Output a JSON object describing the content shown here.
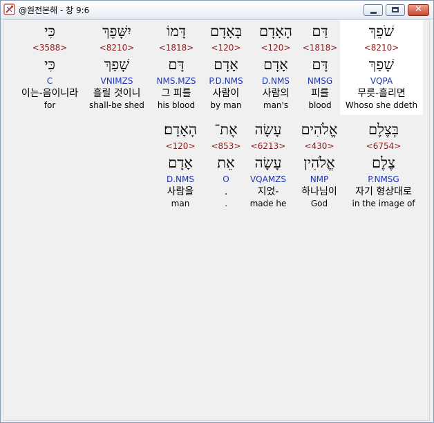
{
  "window": {
    "title": "@원전본해 - 창 9:6",
    "buttons": {
      "minimize": "minimize",
      "maximize": "maximize",
      "close": "✕"
    }
  },
  "words": [
    {
      "hebrew": "שֹׁפֵךְ",
      "strong": "<8210>",
      "lemma": "שָׁפַךְ",
      "morph": "VQPA",
      "korean": "무릇-흘리면",
      "english": "Whoso she ddeth",
      "highlighted": true
    },
    {
      "hebrew": "דַּם",
      "strong": "<1818>",
      "lemma": "דָּם",
      "morph": "NMSG",
      "korean": "피를",
      "english": "blood"
    },
    {
      "hebrew": "הָאָדָם",
      "strong": "<120>",
      "lemma": "אָדָם",
      "morph": "D.NMS",
      "korean": "사람의",
      "english": "man's"
    },
    {
      "hebrew": "בָּאָדָם",
      "strong": "<120>",
      "lemma": "אָדָם",
      "morph": "P.D.NMS",
      "korean": "사람이",
      "english": "by man"
    },
    {
      "hebrew": "דָּמוֹ",
      "strong": "<1818>",
      "lemma": "דָּם",
      "morph": "NMS.MZS",
      "korean": "그 피를",
      "english": "his blood"
    },
    {
      "hebrew": "יִשָּׁפֵךְ",
      "strong": "<8210>",
      "lemma": "שָׁפַךְ",
      "morph": "VNIMZS",
      "korean": "흘릴 것이니",
      "english": "shall-be shed"
    },
    {
      "hebrew": "כִּי",
      "strong": "<3588>",
      "lemma": "כִּי",
      "morph": "C",
      "korean": "이는-음이니라",
      "english": "for"
    },
    {
      "hebrew": "בְּצֶלֶם",
      "strong": "<6754>",
      "lemma": "צֶלֶם",
      "morph": "P.NMSG",
      "korean": "자기 형상대로",
      "english": "in the image of"
    },
    {
      "hebrew": "אֱלֹהִים",
      "strong": "<430>",
      "lemma": "אֱלֹהִין",
      "morph": "NMP",
      "korean": "하나님이",
      "english": "God"
    },
    {
      "hebrew": "עָשָׂה",
      "strong": "<6213>",
      "lemma": "עָשָׂה",
      "morph": "VQAMZS",
      "korean": "지었-",
      "english": "made he"
    },
    {
      "hebrew": "אֶת־",
      "strong": "<853>",
      "lemma": "אֵת",
      "morph": "O",
      "korean": ".",
      "english": "."
    },
    {
      "hebrew": "הָאָדָם׃",
      "strong": "<120>",
      "lemma": "אָדָם",
      "morph": "D.NMS",
      "korean": "사람을",
      "english": "man"
    }
  ]
}
